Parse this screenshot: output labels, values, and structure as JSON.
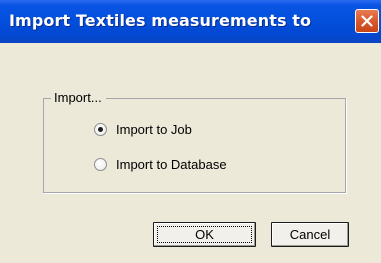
{
  "window": {
    "title": "Import Textiles measurements to",
    "close_icon": "close-icon",
    "title_bar_color": "#0350dd",
    "close_button_color": "#d95a2c",
    "dialog_background": "#ece9d8"
  },
  "group": {
    "label": "Import...",
    "options": [
      {
        "label": "Import to Job",
        "selected": true
      },
      {
        "label": "Import to Database",
        "selected": false
      }
    ]
  },
  "buttons": {
    "ok_label": "OK",
    "cancel_label": "Cancel"
  }
}
